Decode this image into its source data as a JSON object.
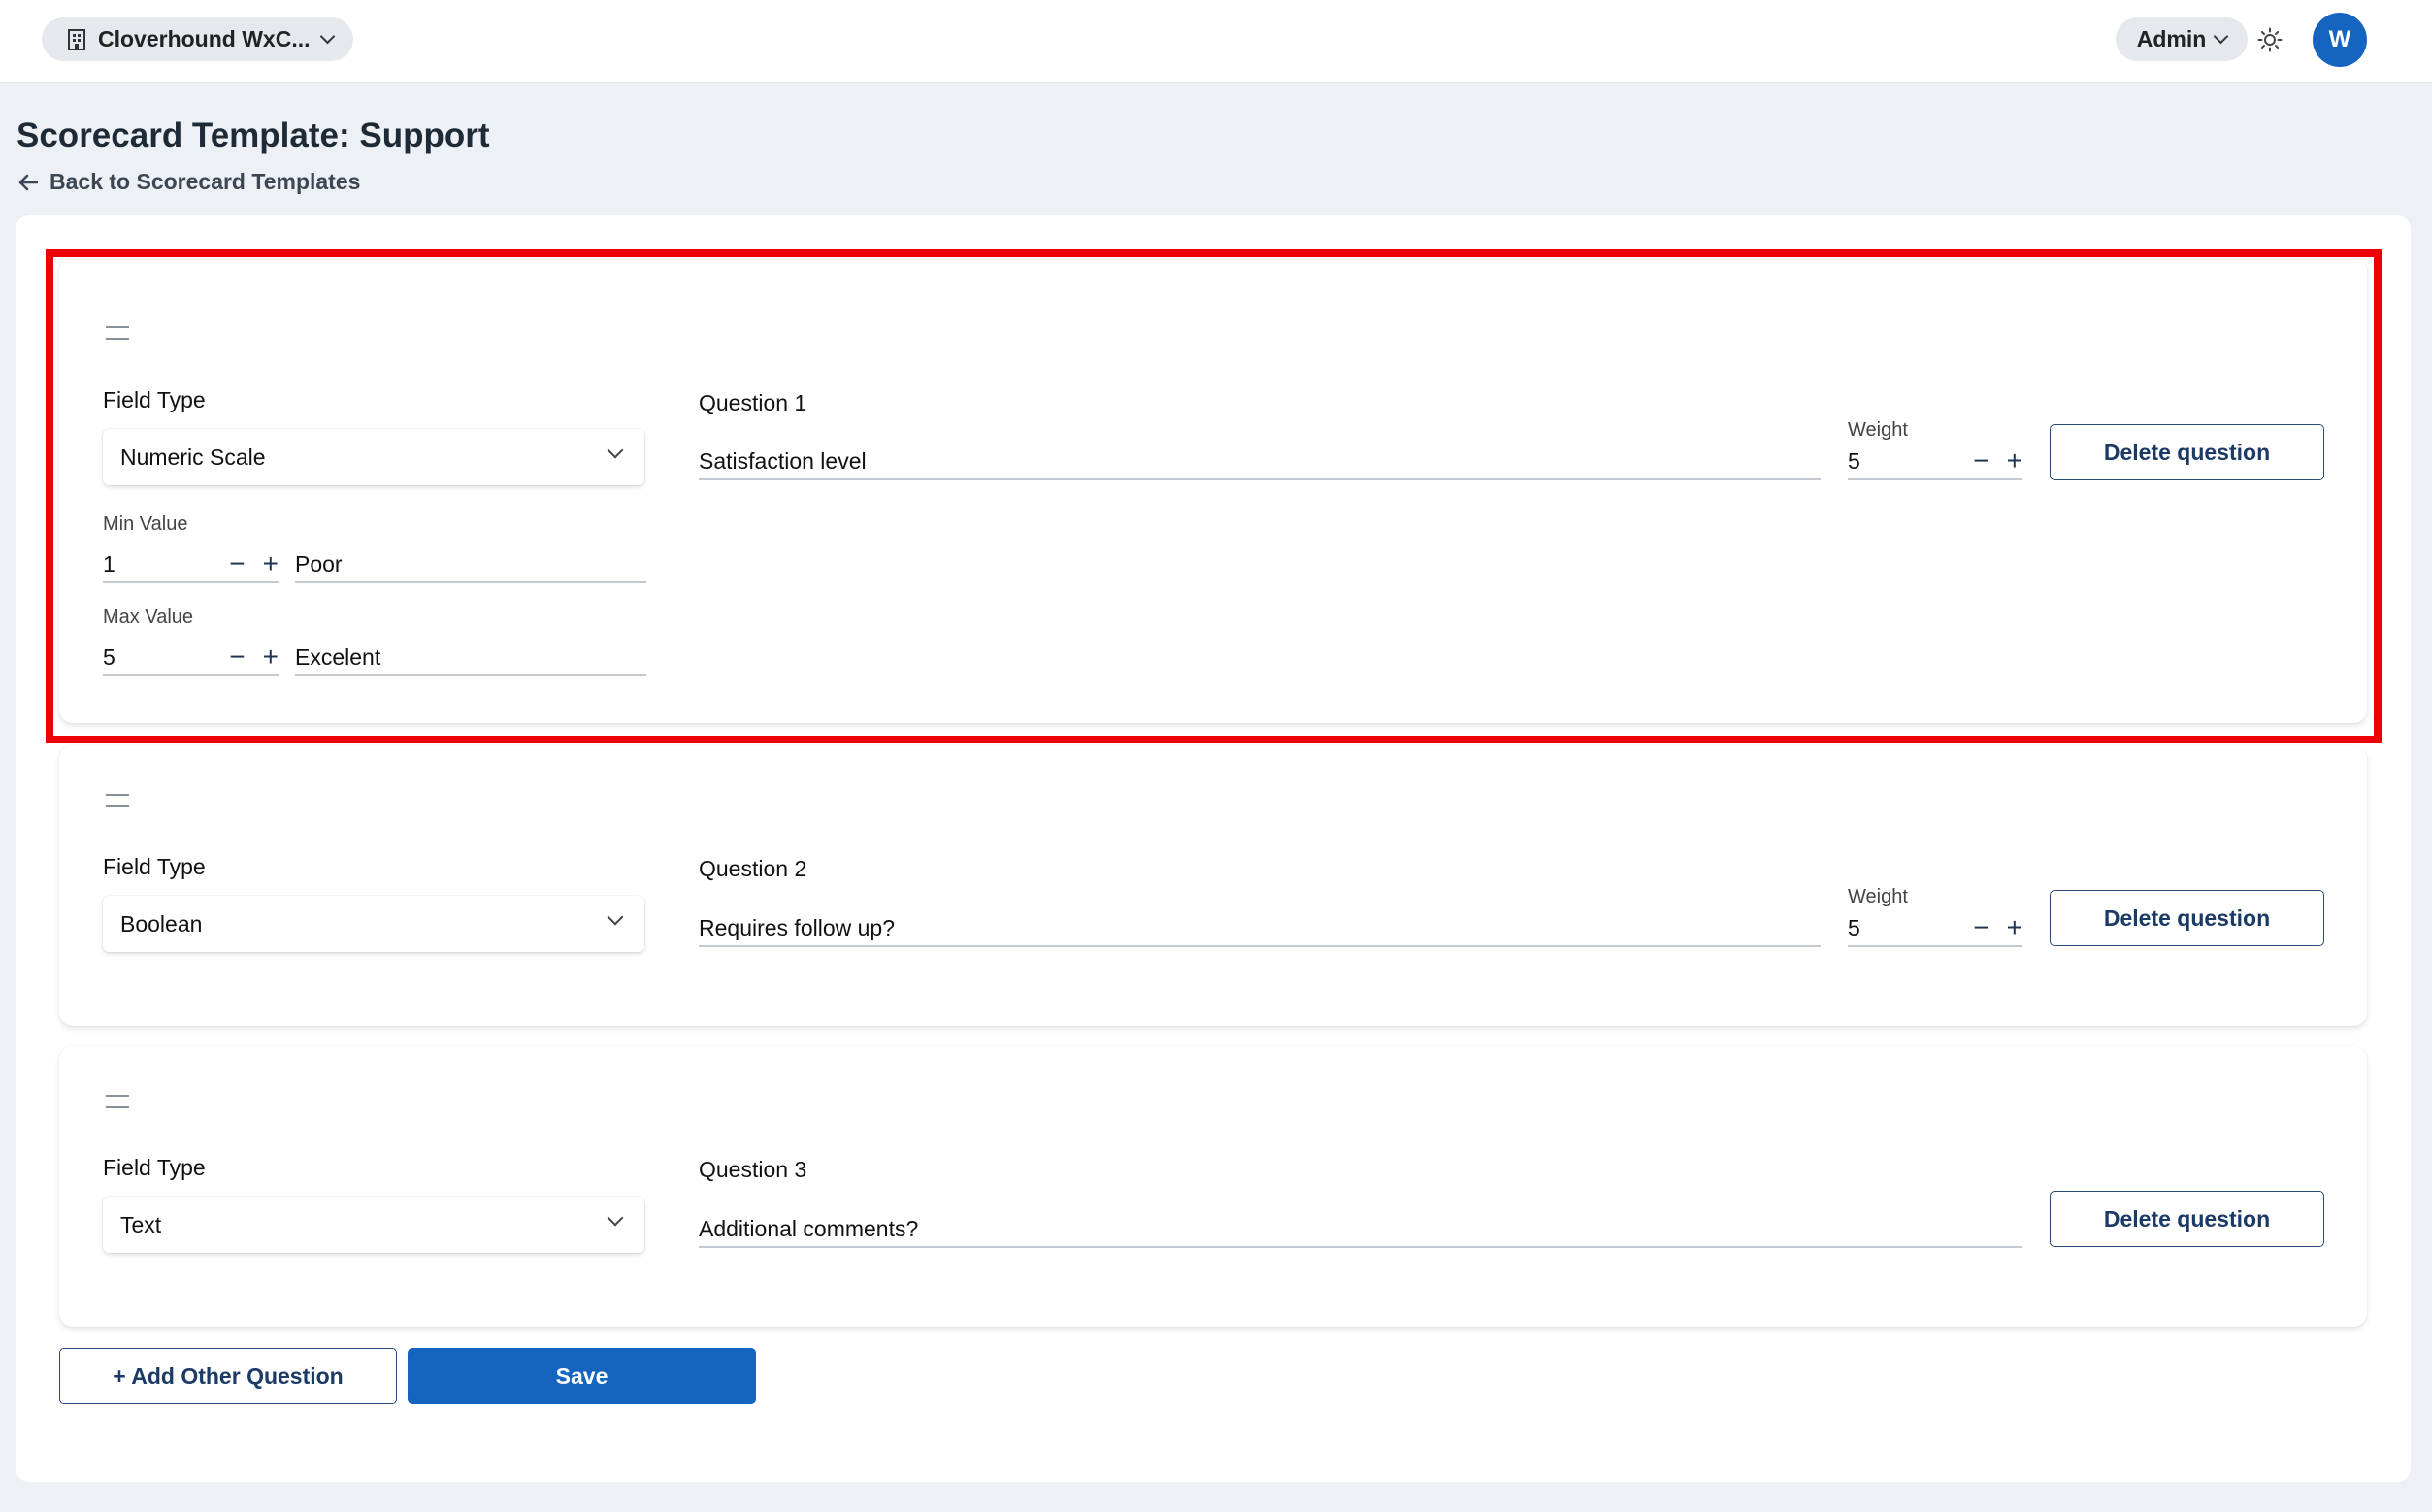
{
  "header": {
    "org_name": "Cloverhound WxC...",
    "org_icon": "building-icon",
    "role": "Admin",
    "theme_icon": "sun-icon",
    "avatar_initial": "W"
  },
  "page": {
    "title": "Scorecard Template: Support",
    "back_label": "Back to Scorecard Templates"
  },
  "questions": [
    {
      "field_type_label": "Field Type",
      "field_type": "Numeric Scale",
      "question_label": "Question 1",
      "question_text": "Satisfaction level",
      "weight_label": "Weight",
      "weight": "5",
      "delete_label": "Delete question",
      "min_label": "Min Value",
      "min_value": "1",
      "min_text": "Poor",
      "max_label": "Max Value",
      "max_value": "5",
      "max_text": "Excelent"
    },
    {
      "field_type_label": "Field Type",
      "field_type": "Boolean",
      "question_label": "Question 2",
      "question_text": "Requires follow up?",
      "weight_label": "Weight",
      "weight": "5",
      "delete_label": "Delete question"
    },
    {
      "field_type_label": "Field Type",
      "field_type": "Text",
      "question_label": "Question 3",
      "question_text": "Additional comments?",
      "delete_label": "Delete question"
    }
  ],
  "stepper": {
    "minus": "−",
    "plus": "+"
  },
  "actions": {
    "add_label": "+ Add Other Question",
    "save_label": "Save"
  },
  "colors": {
    "primary": "#1565c0",
    "highlight": "#ee0000",
    "background": "#edf1f5"
  }
}
